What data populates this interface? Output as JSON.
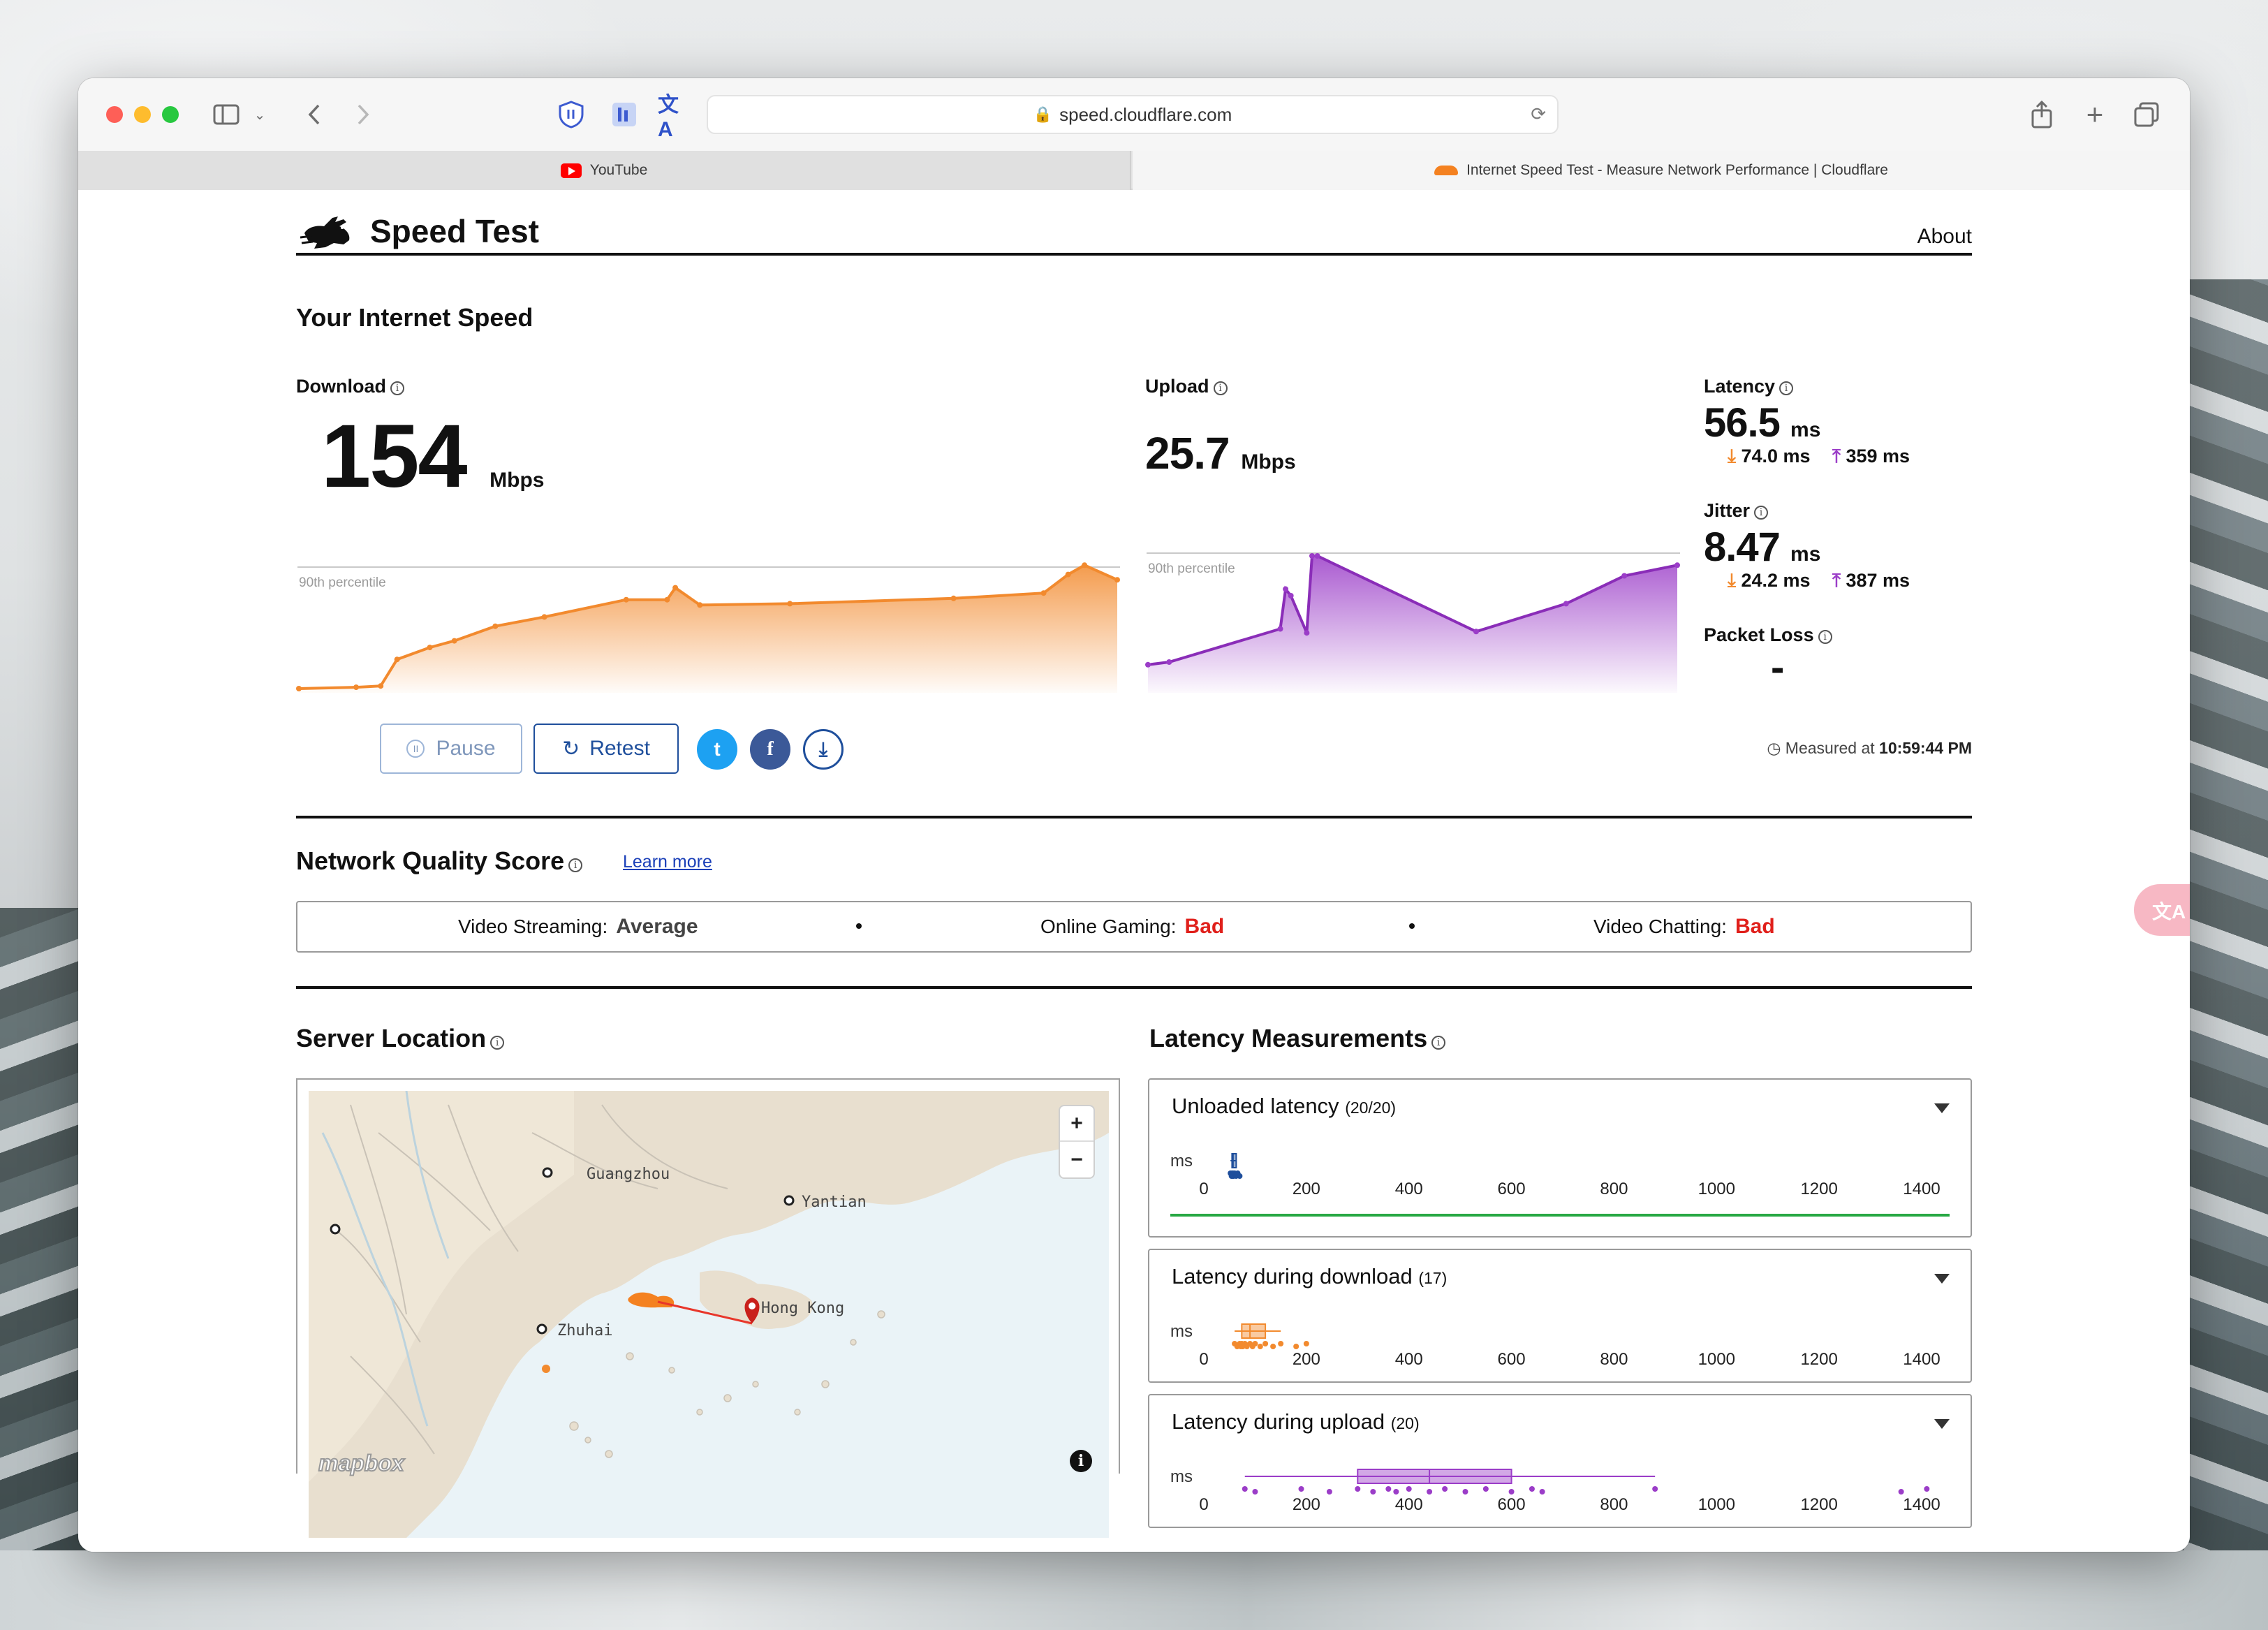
{
  "browser": {
    "url": "speed.cloudflare.com",
    "tabs": [
      {
        "label": "YouTube"
      },
      {
        "label": "Internet Speed Test - Measure Network Performance | Cloudflare"
      }
    ]
  },
  "header": {
    "brand": "Speed Test",
    "nav_about": "About"
  },
  "speed": {
    "section_title": "Your Internet Speed",
    "download": {
      "label": "Download",
      "value": "154",
      "unit": "Mbps",
      "percentile_label": "90th percentile"
    },
    "upload": {
      "label": "Upload",
      "value": "25.7",
      "unit": "Mbps",
      "percentile_label": "90th percentile"
    },
    "latency": {
      "label": "Latency",
      "value": "56.5",
      "unit": "ms",
      "down": "74.0 ms",
      "up": "359 ms"
    },
    "jitter": {
      "label": "Jitter",
      "value": "8.47",
      "unit": "ms",
      "down": "24.2 ms",
      "up": "387 ms"
    },
    "packet_loss": {
      "label": "Packet Loss",
      "value": "-"
    }
  },
  "actions": {
    "pause": "Pause",
    "retest": "Retest",
    "twitter_glyph": "t",
    "facebook_glyph": "f",
    "download_glyph": "⤓",
    "measured_prefix": "Measured at",
    "measured_time": "10:59:44 PM"
  },
  "network_quality": {
    "title": "Network Quality Score",
    "learn_more": "Learn more",
    "items": [
      {
        "label": "Video Streaming:",
        "value": "Average"
      },
      {
        "label": "Online Gaming:",
        "value": "Bad"
      },
      {
        "label": "Video Chatting:",
        "value": "Bad"
      }
    ]
  },
  "server_location": {
    "title": "Server Location",
    "map_labels": [
      "Guangzhou",
      "Yantian",
      "Zhuhai",
      "Hong Kong"
    ],
    "zoom_in": "+",
    "zoom_out": "−",
    "attribution": "mapbox"
  },
  "latency_measurements": {
    "title": "Latency Measurements",
    "axis_unit": "ms",
    "axis_ticks": [
      "0",
      "200",
      "400",
      "600",
      "800",
      "1000",
      "1200",
      "1400"
    ],
    "cards": [
      {
        "title": "Unloaded latency",
        "count": "(20/20)"
      },
      {
        "title": "Latency during download",
        "count": "(17)"
      },
      {
        "title": "Latency during upload",
        "count": "(20)"
      }
    ]
  },
  "colors": {
    "download": "#f28a2e",
    "upload": "#9b3dc8",
    "bad": "#e0201b",
    "link": "#1a3fb8"
  },
  "chart_data": [
    {
      "type": "area",
      "series": [
        {
          "name": "Download",
          "x": [
            0,
            7,
            10,
            12,
            16,
            19,
            24,
            30,
            40,
            45,
            46,
            49,
            60,
            80,
            91,
            94,
            96,
            100
          ],
          "values": [
            0,
            1,
            2,
            22,
            31,
            36,
            47,
            54,
            67,
            67,
            76,
            63,
            64,
            68,
            72,
            86,
            93,
            82
          ]
        }
      ]
    },
    {
      "type": "area",
      "series": [
        {
          "name": "Upload",
          "x": [
            0,
            4,
            25,
            26,
            27,
            30,
            31,
            32,
            62,
            79,
            90,
            100
          ],
          "values": [
            18,
            20,
            45,
            75,
            70,
            42,
            100,
            100,
            43,
            64,
            85,
            93
          ]
        }
      ]
    },
    {
      "type": "scatter",
      "x_range": [
        0,
        1400
      ],
      "series": [
        {
          "name": "Unloaded latency",
          "values": [
            52,
            54,
            55,
            56,
            57,
            58,
            60,
            63,
            66,
            70
          ]
        },
        {
          "name": "Latency during download",
          "values": [
            60,
            65,
            70,
            72,
            74,
            76,
            80,
            84,
            90,
            95,
            100,
            110,
            120,
            135,
            150,
            180,
            200
          ]
        },
        {
          "name": "Latency during upload",
          "values": [
            80,
            100,
            190,
            245,
            300,
            330,
            360,
            375,
            400,
            440,
            470,
            510,
            550,
            600,
            640,
            660,
            880,
            1360,
            1410
          ]
        }
      ]
    }
  ]
}
